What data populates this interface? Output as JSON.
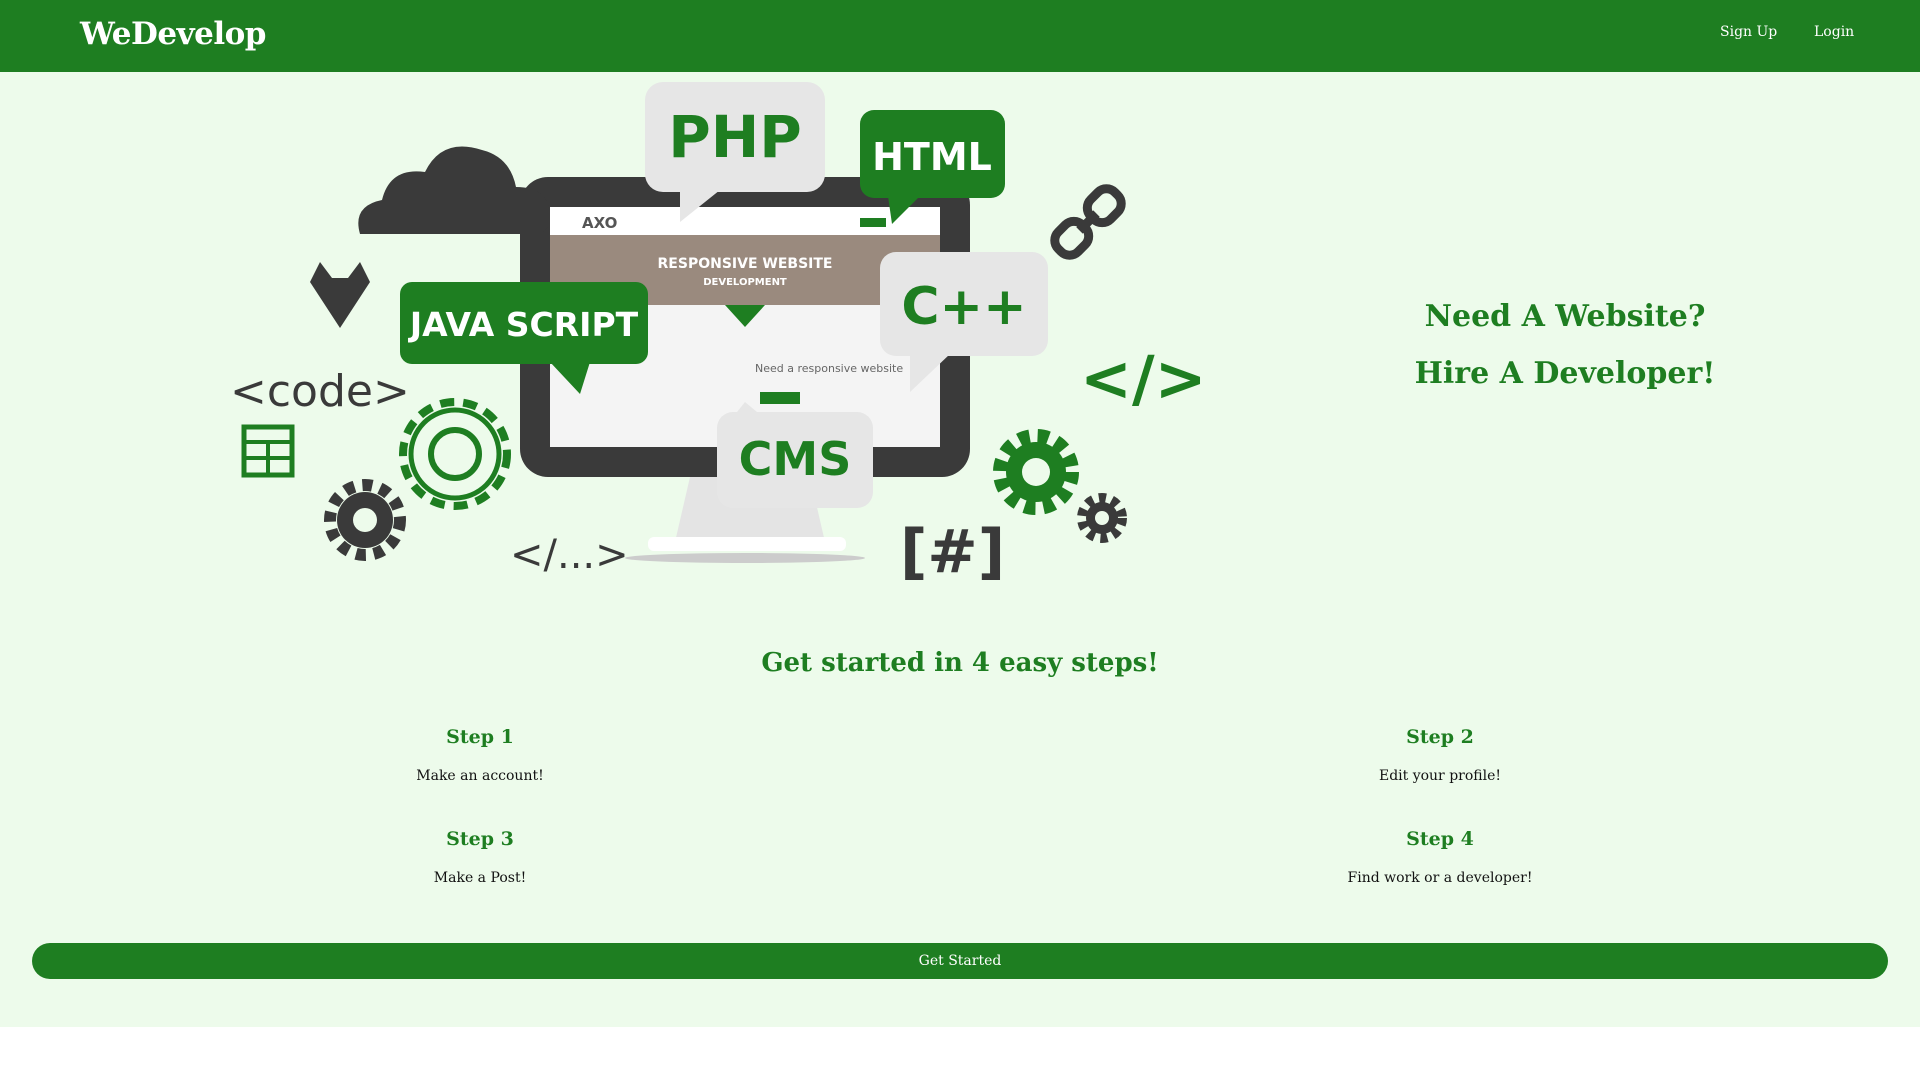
{
  "navbar": {
    "brand": "WeDevelop",
    "links": [
      {
        "label": "Sign Up"
      },
      {
        "label": "Login"
      }
    ]
  },
  "hero": {
    "illustration": {
      "labels": {
        "php": "PHP",
        "html": "HTML",
        "javascript": "JAVA SCRIPT",
        "cpp": "C++",
        "cms": "CMS",
        "code": "<code>",
        "close_tag": "</>",
        "ellipsis_tag": "</...>",
        "hash": "[#]",
        "screen_logo": "AXO",
        "screen_title": "RESPONSIVE WEBSITE",
        "screen_subtitle": "DEVELOPMENT",
        "screen_body": "Need a responsive website"
      },
      "icons": [
        "cloud-icon",
        "gitlab-icon",
        "layout-icon",
        "gear-icon",
        "chain-link-icon",
        "monitor-icon"
      ]
    },
    "heading_line1": "Need A Website?",
    "heading_line2": "Hire A Developer!"
  },
  "steps_section": {
    "heading": "Get started in 4 easy steps!",
    "steps": [
      {
        "title": "Step 1",
        "description": "Make an account!"
      },
      {
        "title": "Step 2",
        "description": "Edit your profile!"
      },
      {
        "title": "Step 3",
        "description": "Make a Post!"
      },
      {
        "title": "Step 4",
        "description": "Find work or a developer!"
      }
    ]
  },
  "cta": {
    "label": "Get Started"
  },
  "colors": {
    "primary_green": "#1e7e21",
    "background_mint": "#edfbeb",
    "dark_gray": "#3a3a3a",
    "bubble_gray": "#e6e6e6"
  }
}
